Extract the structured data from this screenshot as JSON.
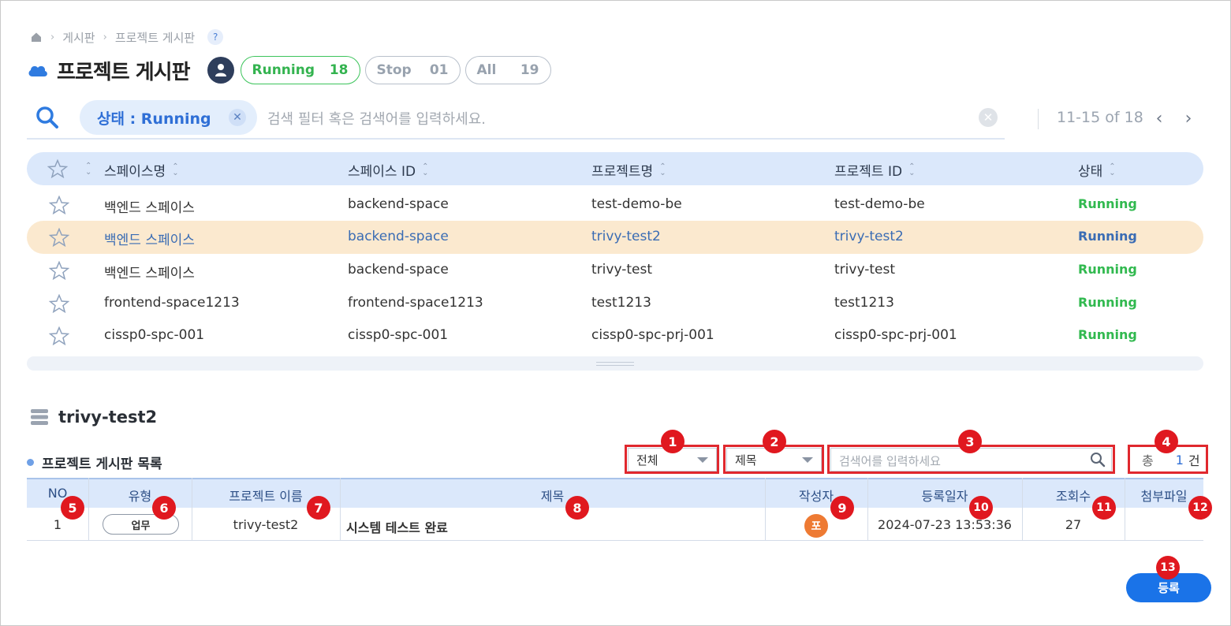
{
  "breadcrumb": {
    "items": [
      "게시판",
      "프로젝트 게시판"
    ],
    "help": "?"
  },
  "page": {
    "title": "프로젝트 게시판"
  },
  "status_filters": [
    {
      "label": "Running",
      "count": "18"
    },
    {
      "label": "Stop",
      "count": "01"
    },
    {
      "label": "All",
      "count": "19"
    }
  ],
  "search": {
    "chip_label": "상태 : Running",
    "chip_close": "✕",
    "placeholder": "검색 필터 혹은 검색어를 입력하세요.",
    "clear": "✕"
  },
  "pager": {
    "range": "11-15 of 18",
    "prev": "‹",
    "next": "›"
  },
  "projects_table": {
    "columns": [
      "스페이스명",
      "스페이스 ID",
      "프로젝트명",
      "프로젝트 ID",
      "상태"
    ],
    "rows": [
      [
        "백엔드 스페이스",
        "backend-space",
        "test-demo-be",
        "test-demo-be",
        "Running"
      ],
      [
        "백엔드 스페이스",
        "backend-space",
        "trivy-test2",
        "trivy-test2",
        "Running"
      ],
      [
        "백엔드 스페이스",
        "backend-space",
        "trivy-test",
        "trivy-test",
        "Running"
      ],
      [
        "frontend-space1213",
        "frontend-space1213",
        "test1213",
        "test1213",
        "Running"
      ],
      [
        "cissp0-spc-001",
        "cissp0-spc-001",
        "cissp0-spc-prj-001",
        "cissp0-spc-prj-001",
        "Running"
      ]
    ],
    "selected_row": 1
  },
  "board": {
    "section_title": "trivy-test2",
    "list_title": "프로젝트 게시판 목록",
    "filter_type": "전체",
    "filter_field": "제목",
    "search_placeholder": "검색어를 입력하세요",
    "total_prefix": "총",
    "total_count": "1",
    "total_suffix": "건",
    "columns": [
      "NO",
      "유형",
      "프로젝트 이름",
      "제목",
      "작성자",
      "등록일자",
      "조회수",
      "첨부파일"
    ],
    "rows": [
      {
        "no": "1",
        "type": "업무",
        "project": "trivy-test2",
        "title": "시스템 테스트 완료",
        "author_initial": "포",
        "date": "2024-07-23 13:53:36",
        "views": "27",
        "attachment": ""
      }
    ],
    "register_label": "등록"
  },
  "annotations": [
    "1",
    "2",
    "3",
    "4",
    "5",
    "6",
    "7",
    "8",
    "9",
    "10",
    "11",
    "12",
    "13"
  ],
  "colors": {
    "accent": "#1a73e8",
    "running": "#31b94f",
    "annotation": "#e0181f",
    "selected_row": "#fbe9cf",
    "header": "#dbe8fb"
  }
}
